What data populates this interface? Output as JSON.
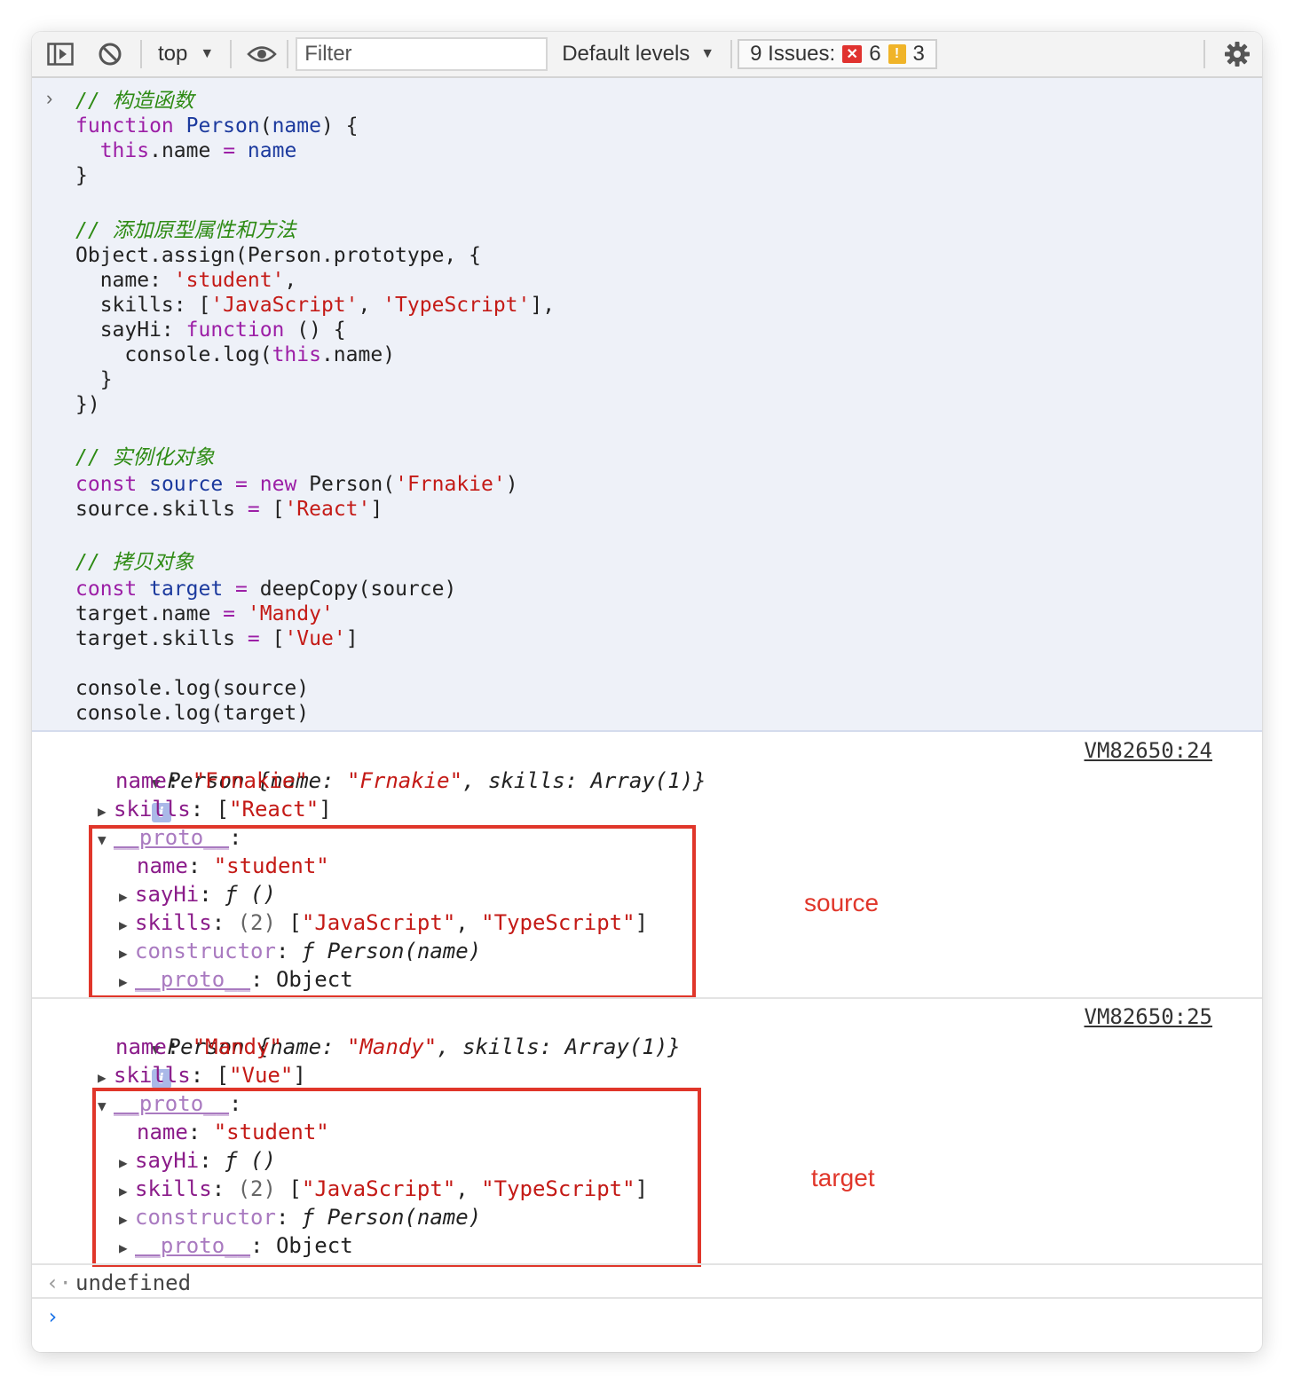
{
  "toolbar": {
    "context": "top",
    "filter_placeholder": "Filter",
    "levels": "Default levels",
    "issues_label": "9 Issues:",
    "errors": "6",
    "warnings": "3"
  },
  "code": [
    [
      [
        "cm",
        "// 构造函数"
      ]
    ],
    [
      [
        "kw",
        "function "
      ],
      [
        "def",
        "Person"
      ],
      [
        "pl",
        "("
      ],
      [
        "def",
        "name"
      ],
      [
        "pl",
        ") {"
      ]
    ],
    [
      [
        "pl",
        "  "
      ],
      [
        "kw",
        "this"
      ],
      [
        "pl",
        ".name "
      ],
      [
        "kw",
        "="
      ],
      [
        "pl",
        " "
      ],
      [
        "def",
        "name"
      ]
    ],
    [
      [
        "pl",
        "}"
      ]
    ],
    [
      [
        "pl",
        ""
      ]
    ],
    [
      [
        "cm",
        "// 添加原型属性和方法"
      ]
    ],
    [
      [
        "pl",
        "Object.assign(Person.prototype, {"
      ]
    ],
    [
      [
        "pl",
        "  name: "
      ],
      [
        "str",
        "'student'"
      ],
      [
        "pl",
        ","
      ]
    ],
    [
      [
        "pl",
        "  skills: ["
      ],
      [
        "str",
        "'JavaScript'"
      ],
      [
        "pl",
        ", "
      ],
      [
        "str",
        "'TypeScript'"
      ],
      [
        "pl",
        "],"
      ]
    ],
    [
      [
        "pl",
        "  sayHi: "
      ],
      [
        "kw",
        "function"
      ],
      [
        "pl",
        " () {"
      ]
    ],
    [
      [
        "pl",
        "    console.log("
      ],
      [
        "kw",
        "this"
      ],
      [
        "pl",
        ".name)"
      ]
    ],
    [
      [
        "pl",
        "  }"
      ]
    ],
    [
      [
        "pl",
        "})"
      ]
    ],
    [
      [
        "pl",
        ""
      ]
    ],
    [
      [
        "cm",
        "// 实例化对象"
      ]
    ],
    [
      [
        "kw",
        "const "
      ],
      [
        "def",
        "source"
      ],
      [
        "pl",
        " "
      ],
      [
        "kw",
        "="
      ],
      [
        "pl",
        " "
      ],
      [
        "kw",
        "new"
      ],
      [
        "pl",
        " Person("
      ],
      [
        "str",
        "'Frnakie'"
      ],
      [
        "pl",
        ")"
      ]
    ],
    [
      [
        "pl",
        "source.skills "
      ],
      [
        "kw",
        "="
      ],
      [
        "pl",
        " ["
      ],
      [
        "str",
        "'React'"
      ],
      [
        "pl",
        "]"
      ]
    ],
    [
      [
        "pl",
        ""
      ]
    ],
    [
      [
        "cm",
        "// 拷贝对象"
      ]
    ],
    [
      [
        "kw",
        "const "
      ],
      [
        "def",
        "target"
      ],
      [
        "pl",
        " "
      ],
      [
        "kw",
        "="
      ],
      [
        "pl",
        " deepCopy(source)"
      ]
    ],
    [
      [
        "pl",
        "target.name "
      ],
      [
        "kw",
        "="
      ],
      [
        "pl",
        " "
      ],
      [
        "str",
        "'Mandy'"
      ]
    ],
    [
      [
        "pl",
        "target.skills "
      ],
      [
        "kw",
        "="
      ],
      [
        "pl",
        " ["
      ],
      [
        "str",
        "'Vue'"
      ],
      [
        "pl",
        "]"
      ]
    ],
    [
      [
        "pl",
        ""
      ]
    ],
    [
      [
        "pl",
        "console.log(source)"
      ]
    ],
    [
      [
        "pl",
        "console.log(target)"
      ]
    ]
  ],
  "logs": [
    {
      "header": {
        "prefix": "Person {",
        "k1": "name",
        "v1": "\"Frnakie\"",
        "k2": "skills",
        "v2": "Array(1)}"
      },
      "source_link": "VM82650:24",
      "name_key": "name",
      "name_val": "\"Frnakie\"",
      "skills_key": "skills",
      "skills_val": "[\"React\"]",
      "proto_key": "__proto__",
      "proto": {
        "name_key": "name",
        "name_val": "\"student\"",
        "sayhi_key": "sayHi",
        "sayhi_val": "ƒ ()",
        "skills_key": "skills",
        "skills_count": "(2)",
        "skills_val": "[\"JavaScript\", \"TypeScript\"]",
        "ctor_key": "constructor",
        "ctor_val": "ƒ Person(name)",
        "proto_key": "__proto__",
        "proto_val": "Object"
      },
      "annotation": "source"
    },
    {
      "header": {
        "prefix": "Person {",
        "k1": "name",
        "v1": "\"Mandy\"",
        "k2": "skills",
        "v2": "Array(1)}"
      },
      "source_link": "VM82650:25",
      "name_key": "name",
      "name_val": "\"Mandy\"",
      "skills_key": "skills",
      "skills_val": "[\"Vue\"]",
      "proto_key": "__proto__",
      "proto": {
        "name_key": "name",
        "name_val": "\"student\"",
        "sayhi_key": "sayHi",
        "sayhi_val": "ƒ ()",
        "skills_key": "skills",
        "skills_count": "(2)",
        "skills_val": "[\"JavaScript\", \"TypeScript\"]",
        "ctor_key": "constructor",
        "ctor_val": "ƒ Person(name)",
        "proto_key": "__proto__",
        "proto_val": "Object"
      },
      "annotation": "target"
    }
  ],
  "result": "undefined",
  "colors": {
    "annotation": "#e0362a",
    "comment": "#2e8b14",
    "keyword": "#9c1fa6",
    "string": "#c41a16"
  }
}
